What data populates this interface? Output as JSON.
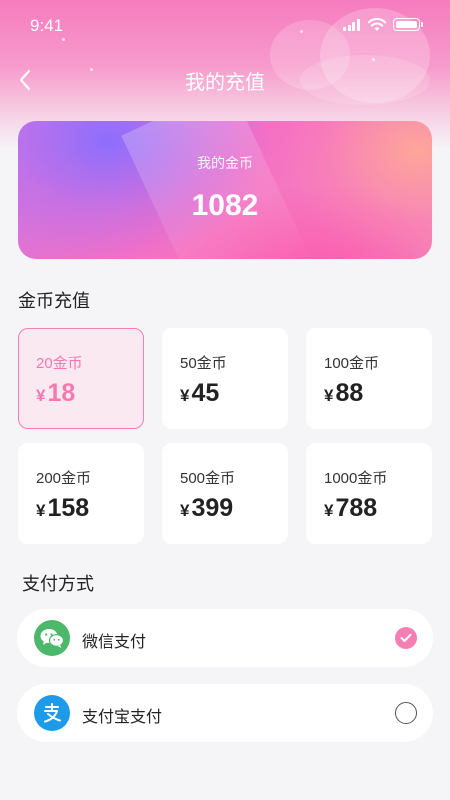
{
  "status_bar": {
    "time": "9:41"
  },
  "nav": {
    "title": "我的充值"
  },
  "balance": {
    "label": "我的金币",
    "value": "1082"
  },
  "recharge_section": {
    "title": "金币充值",
    "selected_index": 0,
    "packages": [
      {
        "coins": "20金币",
        "currency": "¥",
        "price": "18"
      },
      {
        "coins": "50金币",
        "currency": "¥",
        "price": "45"
      },
      {
        "coins": "100金币",
        "currency": "¥",
        "price": "88"
      },
      {
        "coins": "200金币",
        "currency": "¥",
        "price": "158"
      },
      {
        "coins": "500金币",
        "currency": "¥",
        "price": "399"
      },
      {
        "coins": "1000金币",
        "currency": "¥",
        "price": "788"
      }
    ]
  },
  "payment_section": {
    "title": "支付方式",
    "methods": [
      {
        "label": "微信支付",
        "icon": "wechat-pay-icon",
        "selected": true
      },
      {
        "label": "支付宝支付",
        "icon": "alipay-icon",
        "selected": false
      }
    ]
  },
  "colors": {
    "accent_pink": "#f47fb5",
    "selected_bg": "#fbe9f2",
    "wechat_green": "#4cb86a",
    "alipay_blue": "#1e9be8",
    "page_bg": "#f5f5f8"
  }
}
